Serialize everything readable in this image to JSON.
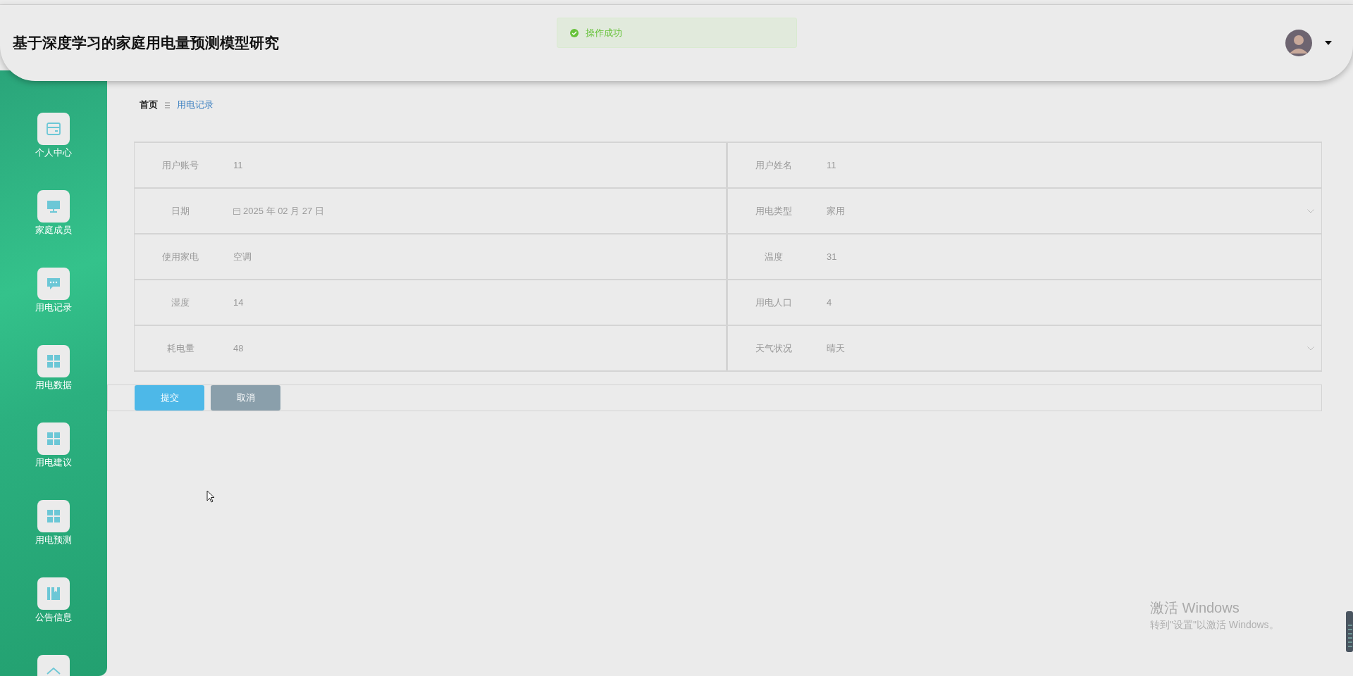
{
  "header": {
    "title": "基于深度学习的家庭用电量预测模型研究"
  },
  "toast": {
    "message": "操作成功",
    "kind": "success"
  },
  "sidebar": {
    "items": [
      {
        "label": "个人中心",
        "kind": "card"
      },
      {
        "label": "家庭成员",
        "kind": "monitor"
      },
      {
        "label": "用电记录",
        "kind": "chat"
      },
      {
        "label": "用电数据",
        "kind": "grid"
      },
      {
        "label": "用电建议",
        "kind": "grid"
      },
      {
        "label": "用电预测",
        "kind": "grid"
      },
      {
        "label": "公告信息",
        "kind": "book"
      }
    ]
  },
  "breadcrumb": [
    {
      "label": "首页",
      "selected": false
    },
    {
      "label": "用电记录",
      "selected": true
    }
  ],
  "form": {
    "fields": [
      {
        "label": "用户账号",
        "value": "11",
        "kind": "text"
      },
      {
        "label": "用户姓名",
        "value": "11",
        "kind": "text"
      },
      {
        "label": "日期",
        "value": "2025 年 02 月 27 日",
        "kind": "date"
      },
      {
        "label": "用电类型",
        "value": "家用",
        "kind": "select"
      },
      {
        "label": "使用家电",
        "value": "空调",
        "kind": "text"
      },
      {
        "label": "温度",
        "value": "31",
        "kind": "text"
      },
      {
        "label": "湿度",
        "value": "14",
        "kind": "text"
      },
      {
        "label": "用电人口",
        "value": "4",
        "kind": "text"
      },
      {
        "label": "耗电量",
        "value": "48",
        "kind": "text"
      },
      {
        "label": "天气状况",
        "value": "晴天",
        "kind": "select"
      }
    ]
  },
  "buttons": [
    {
      "label": "提交",
      "kind": "primary"
    },
    {
      "label": "取消",
      "kind": "secondary"
    }
  ],
  "os_notice": {
    "title": "激活 Windows",
    "message": "转到\"设置\"以激活 Windows。"
  }
}
